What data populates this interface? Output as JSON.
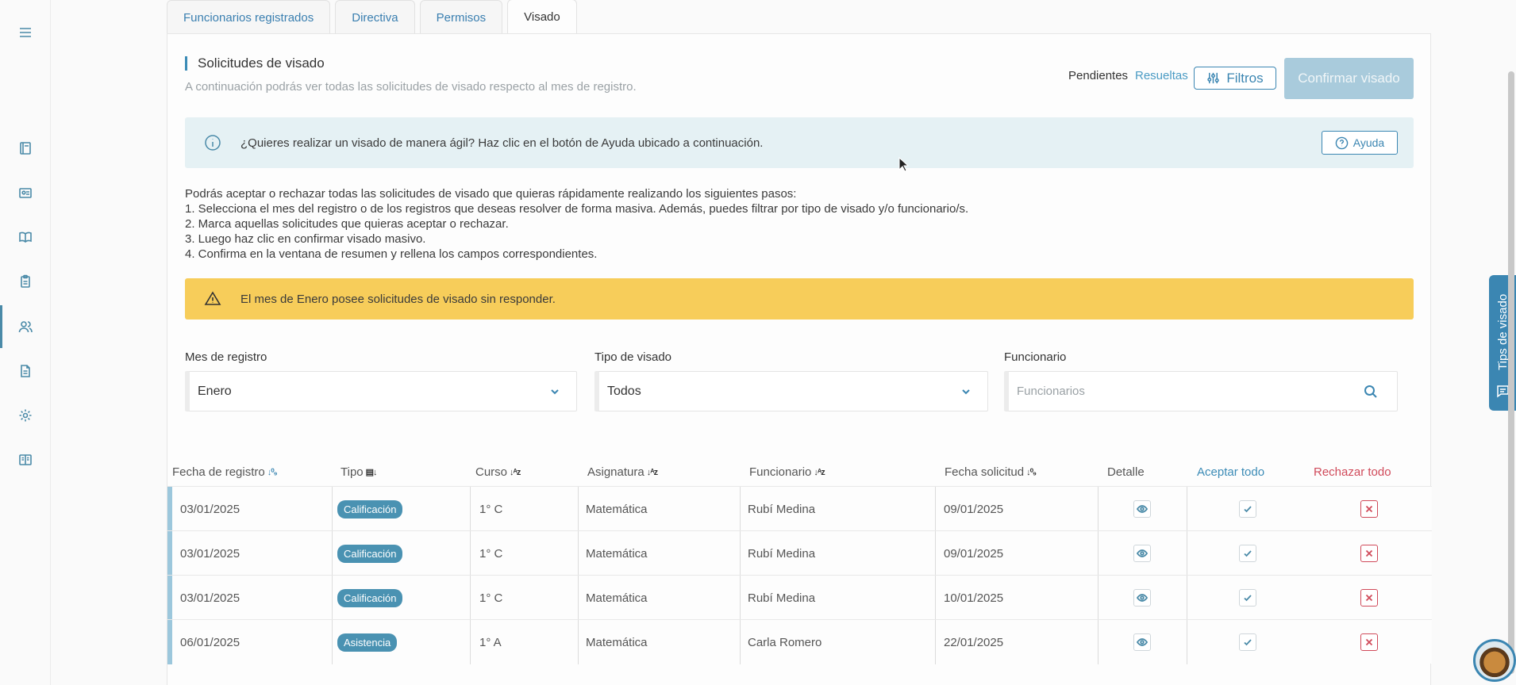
{
  "tabs": [
    {
      "label": "Funcionarios registrados"
    },
    {
      "label": "Directiva"
    },
    {
      "label": "Permisos"
    },
    {
      "label": "Visado"
    }
  ],
  "section": {
    "title": "Solicitudes de visado",
    "subtitle": "A continuación podrás ver todas las solicitudes de visado respecto al mes de registro.",
    "status_pending": "Pendientes",
    "status_resolved": "Resueltas",
    "filters_button": "Filtros",
    "confirm_button": "Confirmar visado"
  },
  "info": {
    "text": "¿Quieres realizar un visado de manera ágil? Haz clic en el botón de Ayuda ubicado a continuación.",
    "help_button": "Ayuda"
  },
  "steps": [
    "Podrás aceptar o rechazar todas las solicitudes de visado que quieras rápidamente realizando los siguientes pasos:",
    "1. Selecciona el mes del registro o de los registros que deseas resolver de forma masiva. Además, puedes filtrar por tipo de visado y/o funcionario/s.",
    "2. Marca aquellas solicitudes que quieras aceptar o rechazar.",
    "3. Luego haz clic en confirmar visado masivo.",
    "4. Confirma en la ventana de resumen y rellena los campos correspondientes."
  ],
  "warning": {
    "text": "El mes de Enero posee solicitudes de visado sin responder."
  },
  "filters": {
    "month": {
      "label": "Mes de registro",
      "value": "Enero"
    },
    "type": {
      "label": "Tipo de visado",
      "value": "Todos"
    },
    "official": {
      "label": "Funcionario",
      "placeholder": "Funcionarios"
    }
  },
  "table": {
    "headers": {
      "fecha_registro": "Fecha de registro",
      "tipo": "Tipo",
      "curso": "Curso",
      "asignatura": "Asignatura",
      "funcionario": "Funcionario",
      "fecha_solicitud": "Fecha solicitud",
      "detalle": "Detalle",
      "aceptar": "Aceptar todo",
      "rechazar": "Rechazar todo"
    },
    "rows": [
      {
        "fecha_registro": "03/01/2025",
        "tipo": "Calificación",
        "curso": "1° C",
        "asignatura": "Matemática",
        "funcionario": "Rubí Medina",
        "fecha_solicitud": "09/01/2025"
      },
      {
        "fecha_registro": "03/01/2025",
        "tipo": "Calificación",
        "curso": "1° C",
        "asignatura": "Matemática",
        "funcionario": "Rubí Medina",
        "fecha_solicitud": "09/01/2025"
      },
      {
        "fecha_registro": "03/01/2025",
        "tipo": "Calificación",
        "curso": "1° C",
        "asignatura": "Matemática",
        "funcionario": "Rubí Medina",
        "fecha_solicitud": "10/01/2025"
      },
      {
        "fecha_registro": "06/01/2025",
        "tipo": "Asistencia",
        "curso": "1° A",
        "asignatura": "Matemática",
        "funcionario": "Carla Romero",
        "fecha_solicitud": "22/01/2025"
      }
    ]
  },
  "tips_tab": {
    "label": "Tips de visado"
  },
  "colors": {
    "accent": "#3b86b2",
    "warning": "#f7cd5a",
    "info_bg": "#e5f1f4",
    "reject": "#d04a5a",
    "badge": "#4a92b2"
  },
  "sort_icons": {
    "numeric": "0-9",
    "alpha": "A-Z"
  }
}
